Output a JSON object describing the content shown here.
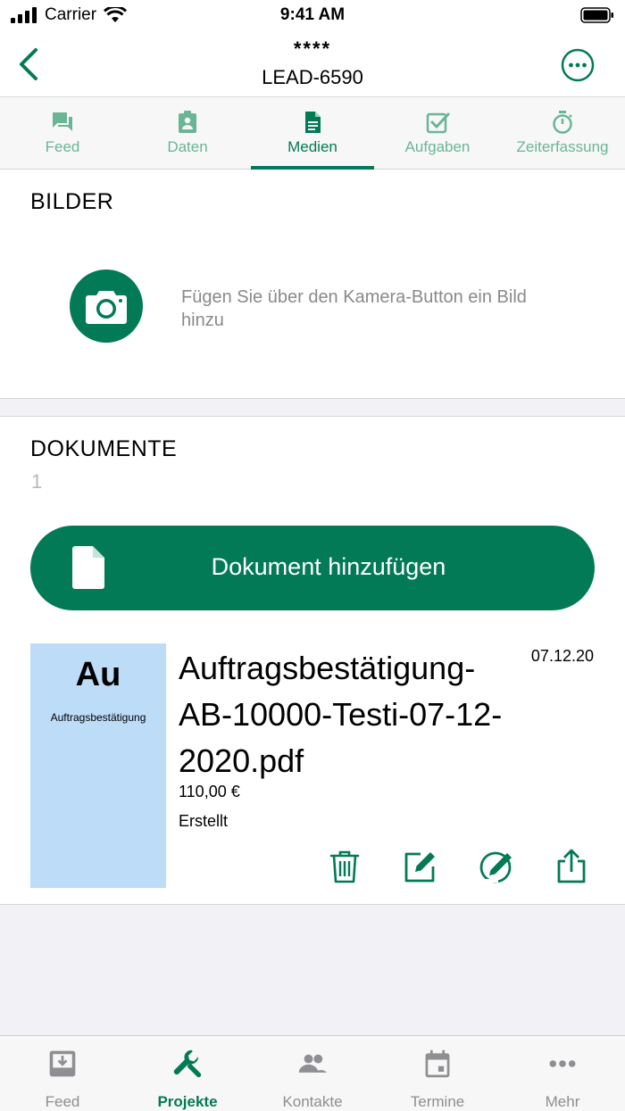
{
  "status_bar": {
    "carrier": "Carrier",
    "time": "9:41 AM"
  },
  "nav": {
    "masked_title": "****",
    "title": "LEAD-6590"
  },
  "tabs": [
    {
      "label": "Feed",
      "icon": "chat-icon",
      "active": false
    },
    {
      "label": "Daten",
      "icon": "contact-card-icon",
      "active": false
    },
    {
      "label": "Medien",
      "icon": "document-icon",
      "active": true
    },
    {
      "label": "Aufgaben",
      "icon": "checkbox-icon",
      "active": false
    },
    {
      "label": "Zeiterfassung",
      "icon": "stopwatch-icon",
      "active": false
    }
  ],
  "bilder": {
    "title": "BILDER",
    "hint": "Fügen Sie über den Kamera-Button ein Bild hinzu"
  },
  "dokumente": {
    "title": "DOKUMENTE",
    "count": "1",
    "add_button": "Dokument hinzufügen",
    "items": [
      {
        "thumb_big": "Au",
        "thumb_small": "Auftragsbestätigung",
        "name": "Auftragsbestätigung-AB-10000-Testi-07-12-2020.pdf",
        "date": "07.12.20",
        "price": "110,00 €",
        "status": "Erstellt"
      }
    ]
  },
  "tabbar": [
    {
      "label": "Feed",
      "icon": "inbox-icon",
      "active": false
    },
    {
      "label": "Projekte",
      "icon": "wrench-icon",
      "active": true
    },
    {
      "label": "Kontakte",
      "icon": "people-icon",
      "active": false
    },
    {
      "label": "Termine",
      "icon": "calendar-icon",
      "active": false
    },
    {
      "label": "Mehr",
      "icon": "more-dots-icon",
      "active": false
    }
  ],
  "colors": {
    "accent": "#037a56",
    "accent_light": "#6bb597",
    "thumb_bg": "#bddcf8",
    "inactive": "#8e8e93"
  }
}
